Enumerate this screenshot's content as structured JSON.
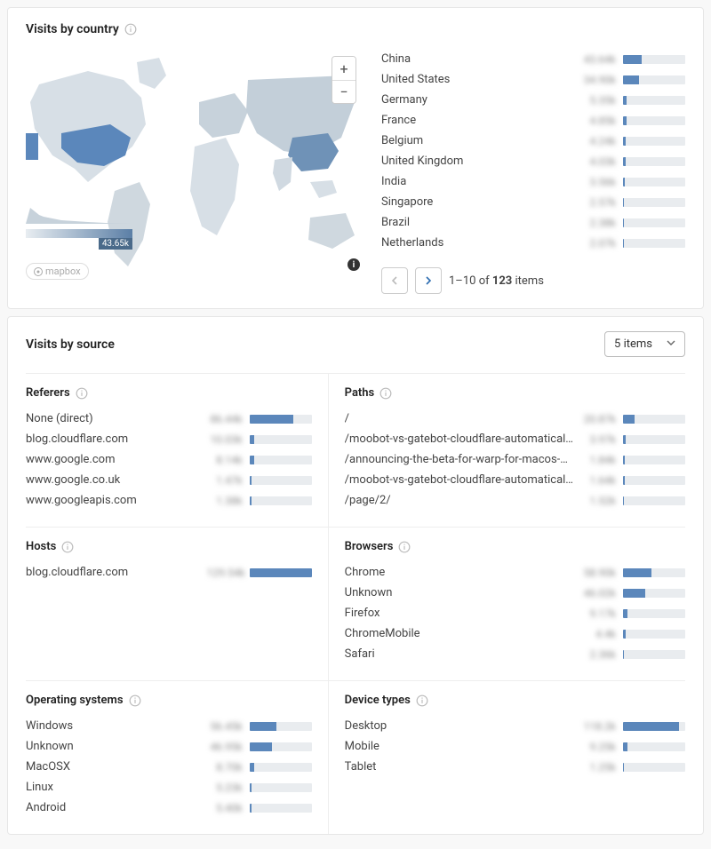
{
  "visits_by_country": {
    "title": "Visits by country",
    "legend_max": "43.65k",
    "mapbox_label": "mapbox",
    "countries": [
      {
        "name": "China",
        "value": "43.64k",
        "pct": 30
      },
      {
        "name": "United States",
        "value": "34.90k",
        "pct": 25
      },
      {
        "name": "Germany",
        "value": "5.35k",
        "pct": 5
      },
      {
        "name": "France",
        "value": "4.85k",
        "pct": 5
      },
      {
        "name": "Belgium",
        "value": "4.24k",
        "pct": 4
      },
      {
        "name": "United Kingdom",
        "value": "4.03k",
        "pct": 4
      },
      {
        "name": "India",
        "value": "3.56k",
        "pct": 3
      },
      {
        "name": "Singapore",
        "value": "2.57k",
        "pct": 2
      },
      {
        "name": "Brazil",
        "value": "2.38k",
        "pct": 2
      },
      {
        "name": "Netherlands",
        "value": "2.07k",
        "pct": 2
      }
    ],
    "pager": {
      "range": "1–10",
      "of_label": "of",
      "total": "123",
      "items_label": "items"
    }
  },
  "visits_by_source": {
    "title": "Visits by source",
    "dropdown_label": "5 items",
    "blocks": {
      "referers": {
        "title": "Referers",
        "rows": [
          {
            "label": "None (direct)",
            "value": "86.44k",
            "pct": 70
          },
          {
            "label": "blog.cloudflare.com",
            "value": "10.03k",
            "pct": 8
          },
          {
            "label": "www.google.com",
            "value": "8.14k",
            "pct": 7
          },
          {
            "label": "www.google.co.uk",
            "value": "1.47k",
            "pct": 3
          },
          {
            "label": "www.googleapis.com",
            "value": "1.38k",
            "pct": 3
          }
        ]
      },
      "paths": {
        "title": "Paths",
        "rows": [
          {
            "label": "/",
            "value": "20.87k",
            "pct": 18
          },
          {
            "label": "/moobot-vs-gatebot-cloudflare-automatical…",
            "value": "3.97k",
            "pct": 4
          },
          {
            "label": "/announcing-the-beta-for-warp-for-macos-…",
            "value": "1.84k",
            "pct": 3
          },
          {
            "label": "/moobot-vs-gatebot-cloudflare-automatical…",
            "value": "1.64k",
            "pct": 3
          },
          {
            "label": "/page/2/",
            "value": "1.52k",
            "pct": 2
          }
        ]
      },
      "hosts": {
        "title": "Hosts",
        "rows": [
          {
            "label": "blog.cloudflare.com",
            "value": "129.54k",
            "pct": 100
          }
        ]
      },
      "browsers": {
        "title": "Browsers",
        "rows": [
          {
            "label": "Chrome",
            "value": "58.90k",
            "pct": 45
          },
          {
            "label": "Unknown",
            "value": "46.02k",
            "pct": 35
          },
          {
            "label": "Firefox",
            "value": "9.17k",
            "pct": 7
          },
          {
            "label": "ChromeMobile",
            "value": "4.4k",
            "pct": 4
          },
          {
            "label": "Safari",
            "value": "2.36k",
            "pct": 2
          }
        ]
      },
      "os": {
        "title": "Operating systems",
        "rows": [
          {
            "label": "Windows",
            "value": "56.45k",
            "pct": 43
          },
          {
            "label": "Unknown",
            "value": "46.95k",
            "pct": 36
          },
          {
            "label": "MacOSX",
            "value": "8.70k",
            "pct": 7
          },
          {
            "label": "Linux",
            "value": "5.23k",
            "pct": 4
          },
          {
            "label": "Android",
            "value": "5.40k",
            "pct": 4
          }
        ]
      },
      "device": {
        "title": "Device types",
        "rows": [
          {
            "label": "Desktop",
            "value": "118.2k",
            "pct": 90
          },
          {
            "label": "Mobile",
            "value": "9.25k",
            "pct": 7
          },
          {
            "label": "Tablet",
            "value": "1.25k",
            "pct": 2
          }
        ]
      }
    }
  }
}
